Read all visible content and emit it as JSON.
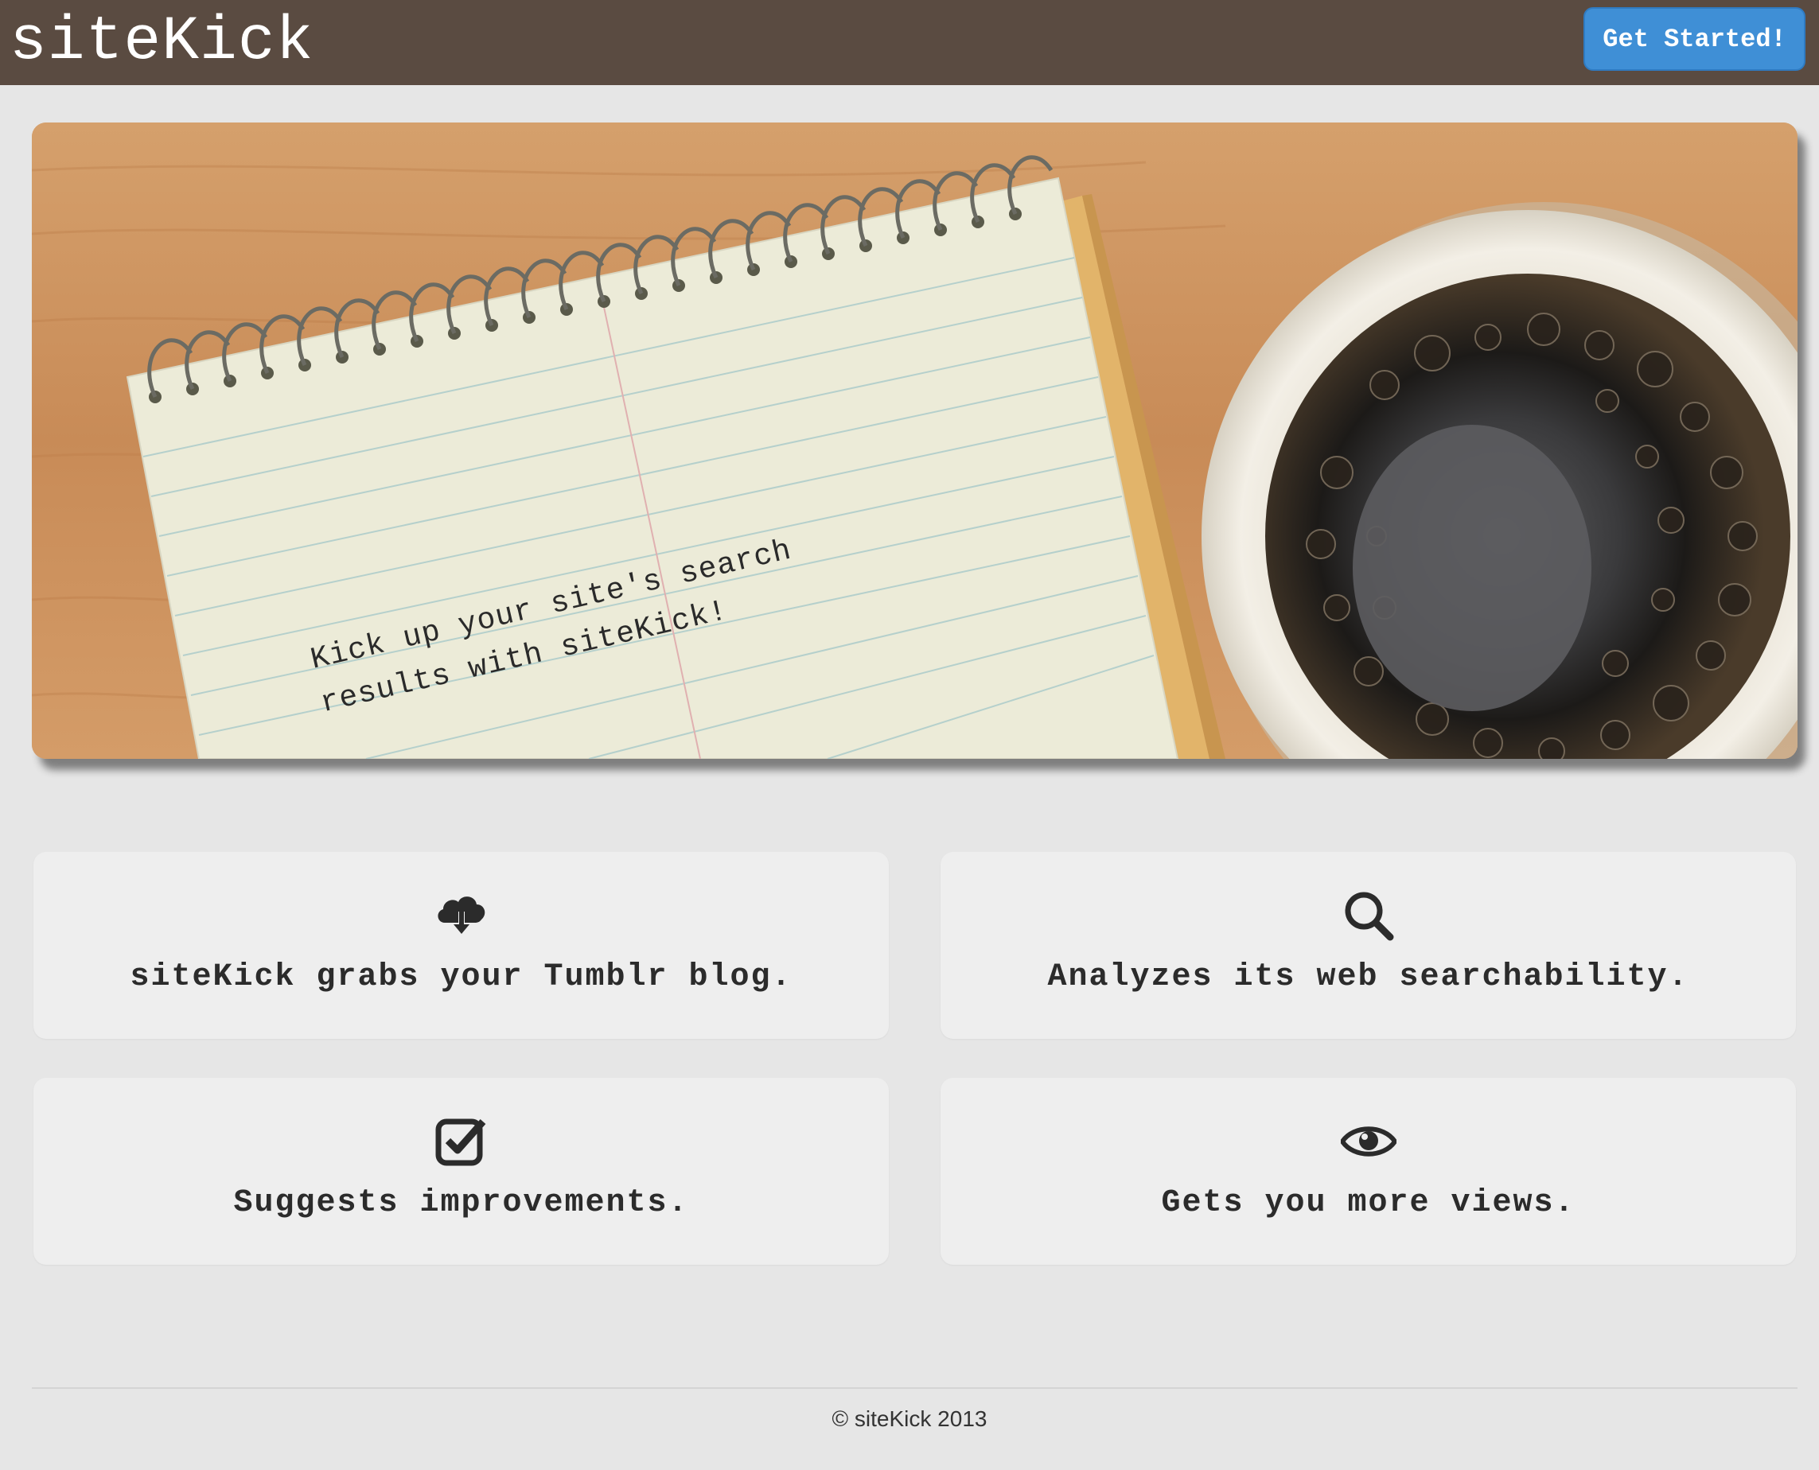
{
  "brand": {
    "name": "siteKick"
  },
  "nav": {
    "cta_label": "Get Started!"
  },
  "hero": {
    "line1": "Kick up your site's search",
    "line2": "results with siteKick!"
  },
  "features": [
    {
      "icon": "cloud-download-icon",
      "label": "siteKick grabs your Tumblr blog."
    },
    {
      "icon": "search-icon",
      "label": "Analyzes its web searchability."
    },
    {
      "icon": "checkbox-check-icon",
      "label": "Suggests improvements."
    },
    {
      "icon": "eye-icon",
      "label": "Gets you more views."
    }
  ],
  "footer": {
    "copyright": "© siteKick 2013"
  },
  "colors": {
    "navbar": "#5a4b41",
    "cta": "#3f8fd6",
    "page_bg": "#e6e6e6",
    "card_bg": "#eeeeee",
    "text": "#2b2b2b"
  }
}
